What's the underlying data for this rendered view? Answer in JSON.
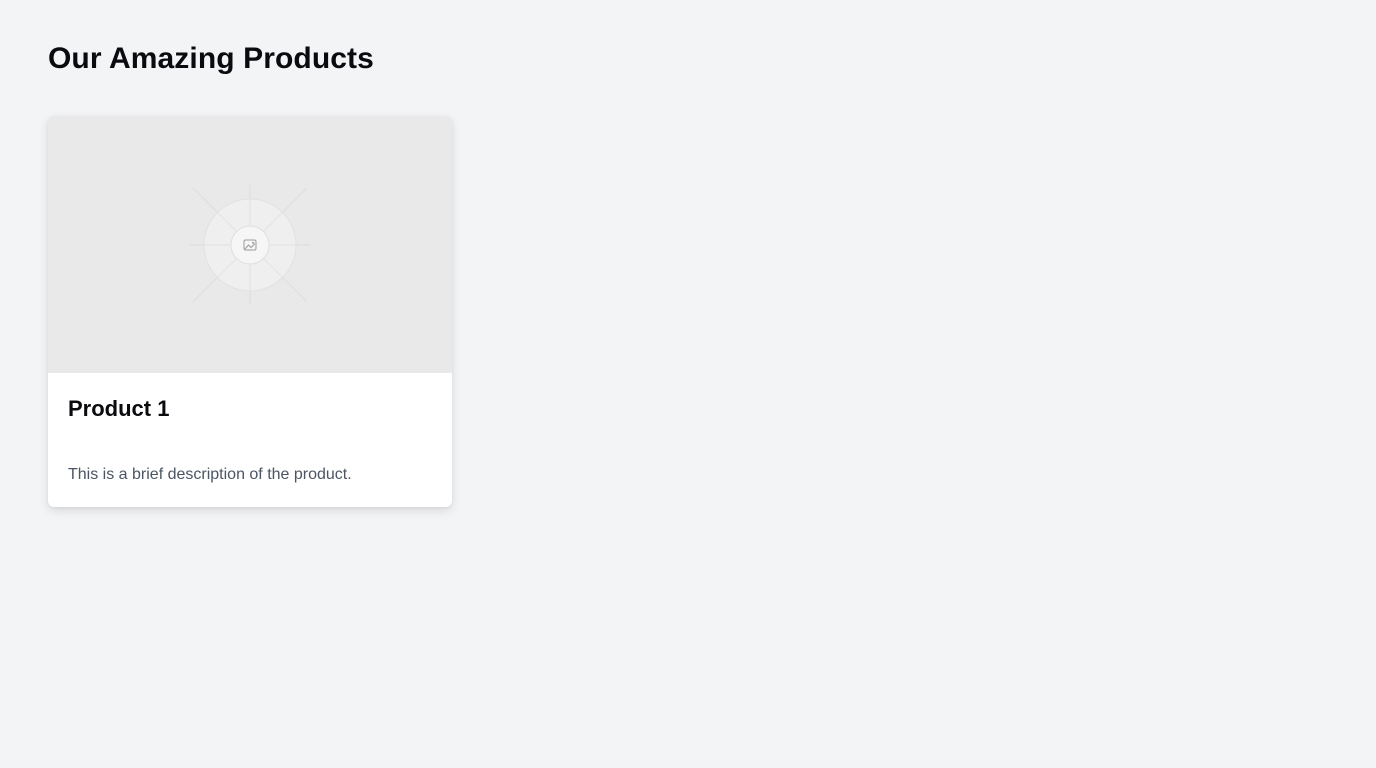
{
  "page": {
    "title": "Our Amazing Products"
  },
  "products": [
    {
      "name": "Product 1",
      "description": "This is a brief description of the product.",
      "image_icon": "image-placeholder-icon"
    }
  ],
  "colors": {
    "background": "#f3f4f6",
    "card": "#ffffff",
    "image_placeholder": "#e9e9e9",
    "title_text": "#0b0b0f",
    "description_text": "#4b5563"
  }
}
